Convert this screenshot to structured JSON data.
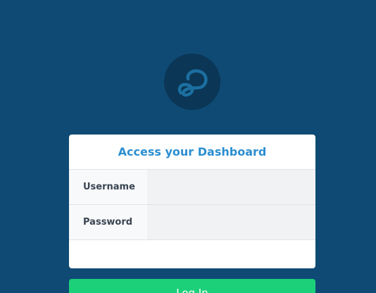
{
  "logo": {
    "icon": "infinity-loop-icon",
    "bg_color": "#0b3656",
    "stroke_color": "#1b6fa0"
  },
  "login": {
    "title": "Access your Dashboard",
    "username_label": "Username",
    "username_value": "",
    "password_label": "Password",
    "password_value": "",
    "submit_label": "Log In"
  },
  "colors": {
    "background": "#0f4a74",
    "title": "#2b8ed0",
    "button": "#1cd07a"
  }
}
